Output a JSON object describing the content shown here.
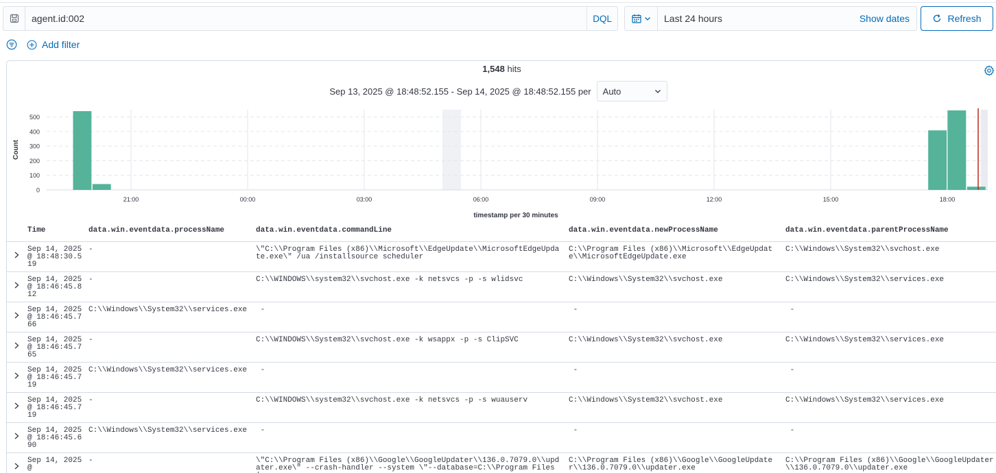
{
  "query": {
    "value": "agent.id:002",
    "language": "DQL"
  },
  "datepicker": {
    "range": "Last 24 hours",
    "show_dates": "Show dates",
    "refresh": "Refresh"
  },
  "filters": {
    "add_filter": "Add filter"
  },
  "histogram": {
    "hits_count": "1,548",
    "hits_label": "hits",
    "interval_text": "Sep 13, 2025 @ 18:48:52.155 - Sep 14, 2025 @ 18:48:52.155 per",
    "interval_value": "Auto"
  },
  "chart_data": {
    "type": "bar",
    "ylabel": "Count",
    "xlabel": "timestamp per 30 minutes",
    "yticks": [
      0,
      100,
      200,
      300,
      400,
      500
    ],
    "xticks": [
      "21:00",
      "00:00",
      "03:00",
      "06:00",
      "09:00",
      "12:00",
      "15:00",
      "18:00"
    ],
    "ylim": [
      0,
      550
    ],
    "bars": [
      {
        "slot": "19:30",
        "value": 540
      },
      {
        "slot": "20:00",
        "value": 40
      },
      {
        "slot": "17:30",
        "value": 408
      },
      {
        "slot": "18:00",
        "value": 545
      },
      {
        "slot": "18:30",
        "value": 22
      }
    ],
    "bar_color": "#54b399"
  },
  "table": {
    "headers": {
      "time": "Time",
      "process_name": "data.win.eventdata.processName",
      "command_line": "data.win.eventdata.commandLine",
      "new_process_name": "data.win.eventdata.newProcessName",
      "parent_process_name": "data.win.eventdata.parentProcessName"
    },
    "rows": [
      {
        "time": "Sep 14, 2025 @ 18:48:30.519",
        "process_name": "-",
        "command_line": "\\\"C:\\\\Program Files (x86)\\\\Microsoft\\\\EdgeUpdate\\\\MicrosoftEdgeUpdate.exe\\\" /ua /installsource scheduler",
        "new_process_name": "C:\\\\Program Files (x86)\\\\Microsoft\\\\EdgeUpdate\\\\MicrosoftEdgeUpdate.exe",
        "parent_process_name": "C:\\\\Windows\\\\System32\\\\svchost.exe"
      },
      {
        "time": "Sep 14, 2025 @ 18:46:45.812",
        "process_name": "-",
        "command_line": "C:\\\\WINDOWS\\\\system32\\\\svchost.exe -k netsvcs -p -s wlidsvc",
        "new_process_name": "C:\\\\Windows\\\\System32\\\\svchost.exe",
        "parent_process_name": "C:\\\\Windows\\\\System32\\\\services.exe"
      },
      {
        "time": "Sep 14, 2025 @ 18:46:45.766",
        "process_name": "C:\\\\Windows\\\\System32\\\\services.exe",
        "command_line": " -",
        "new_process_name": " -",
        "parent_process_name": " -"
      },
      {
        "time": "Sep 14, 2025 @ 18:46:45.765",
        "process_name": "-",
        "command_line": "C:\\\\WINDOWS\\\\System32\\\\svchost.exe -k wsappx -p -s ClipSVC",
        "new_process_name": "C:\\\\Windows\\\\System32\\\\svchost.exe",
        "parent_process_name": "C:\\\\Windows\\\\System32\\\\services.exe"
      },
      {
        "time": "Sep 14, 2025 @ 18:46:45.719",
        "process_name": "C:\\\\Windows\\\\System32\\\\services.exe",
        "command_line": " -",
        "new_process_name": " -",
        "parent_process_name": " -"
      },
      {
        "time": "Sep 14, 2025 @ 18:46:45.719",
        "process_name": "-",
        "command_line": "C:\\\\WINDOWS\\\\system32\\\\svchost.exe -k netsvcs -p -s wuauserv",
        "new_process_name": "C:\\\\Windows\\\\System32\\\\svchost.exe",
        "parent_process_name": "C:\\\\Windows\\\\System32\\\\services.exe"
      },
      {
        "time": "Sep 14, 2025 @ 18:46:45.690",
        "process_name": "C:\\\\Windows\\\\System32\\\\services.exe",
        "command_line": " -",
        "new_process_name": " -",
        "parent_process_name": " -"
      },
      {
        "time": "Sep 14, 2025 @",
        "process_name": "-",
        "command_line": "\\\"C:\\\\Program Files (x86)\\\\Google\\\\GoogleUpdater\\\\136.0.7079.0\\\\updater.exe\\\" --crash-handler --system \\\"--database=C:\\\\Program Files (x",
        "new_process_name": "C:\\\\Program Files (x86)\\\\Google\\\\GoogleUpdater\\\\136.0.7079.0\\\\updater.exe",
        "parent_process_name": "C:\\\\Program Files (x86)\\\\Google\\\\GoogleUpdater\\\\136.0.7079.0\\\\updater.exe"
      }
    ]
  }
}
